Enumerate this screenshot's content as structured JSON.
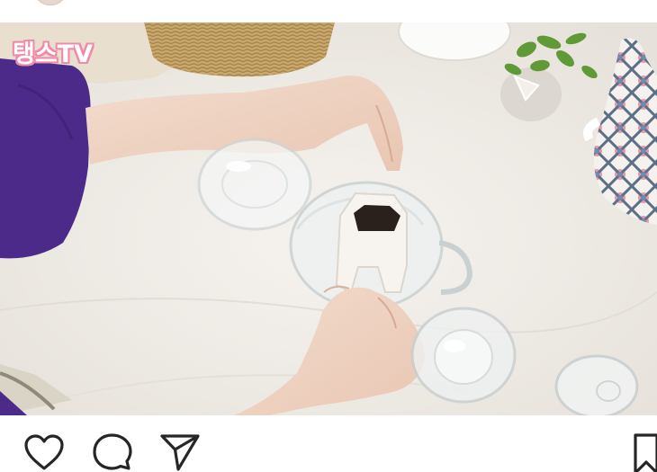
{
  "post": {
    "watermark_text": "탱스TV",
    "watermark_color": "#f08aa6"
  },
  "actions": {
    "icons": [
      "heart-icon",
      "comment-icon",
      "share-icon",
      "bookmark-icon"
    ]
  }
}
